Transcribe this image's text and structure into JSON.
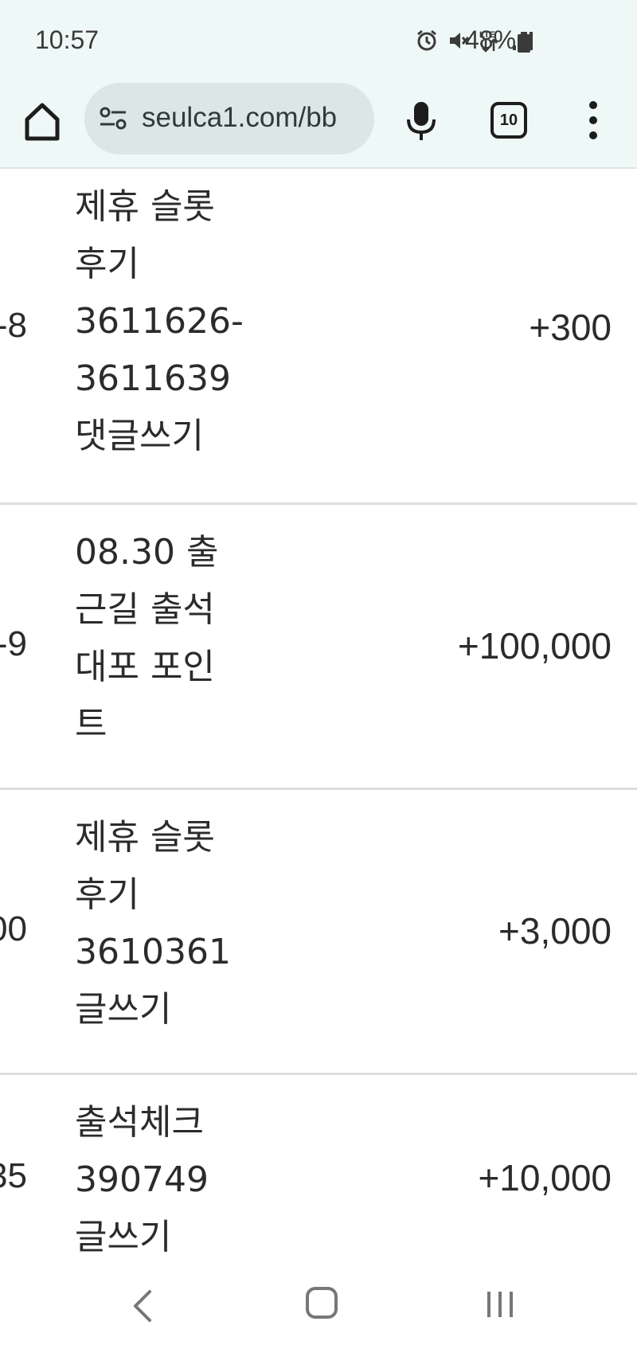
{
  "status_bar": {
    "time": "10:57",
    "battery": "48%",
    "icons": [
      "alarm-icon",
      "mute-icon",
      "lte-icon",
      "signal-icon",
      "battery-icon"
    ]
  },
  "browser": {
    "url": "seulca1.com/bb",
    "tab_count": "10",
    "icons": [
      "home-icon",
      "site-settings-icon",
      "mic-icon",
      "tabs-icon",
      "more-vert-icon"
    ]
  },
  "rows": [
    {
      "id": "-8",
      "desc_lines": [
        "제휴 슬롯",
        "후기",
        "3611626-",
        "3611639",
        "댓글쓰기"
      ],
      "points": "+300"
    },
    {
      "id": "-9",
      "desc_lines": [
        "08.30 출",
        "근길 출석",
        "대포 포인",
        "트"
      ],
      "points": "+100,000"
    },
    {
      "id": "00",
      "desc_lines": [
        "제휴 슬롯",
        "후기",
        "3610361",
        "글쓰기"
      ],
      "points": "+3,000"
    },
    {
      "id": "35",
      "desc_lines": [
        "출석체크",
        "390749",
        "글쓰기"
      ],
      "points": "+10,000"
    }
  ],
  "nav": {
    "icons": [
      "back-icon",
      "home-circle-icon",
      "recent-apps-icon"
    ]
  }
}
